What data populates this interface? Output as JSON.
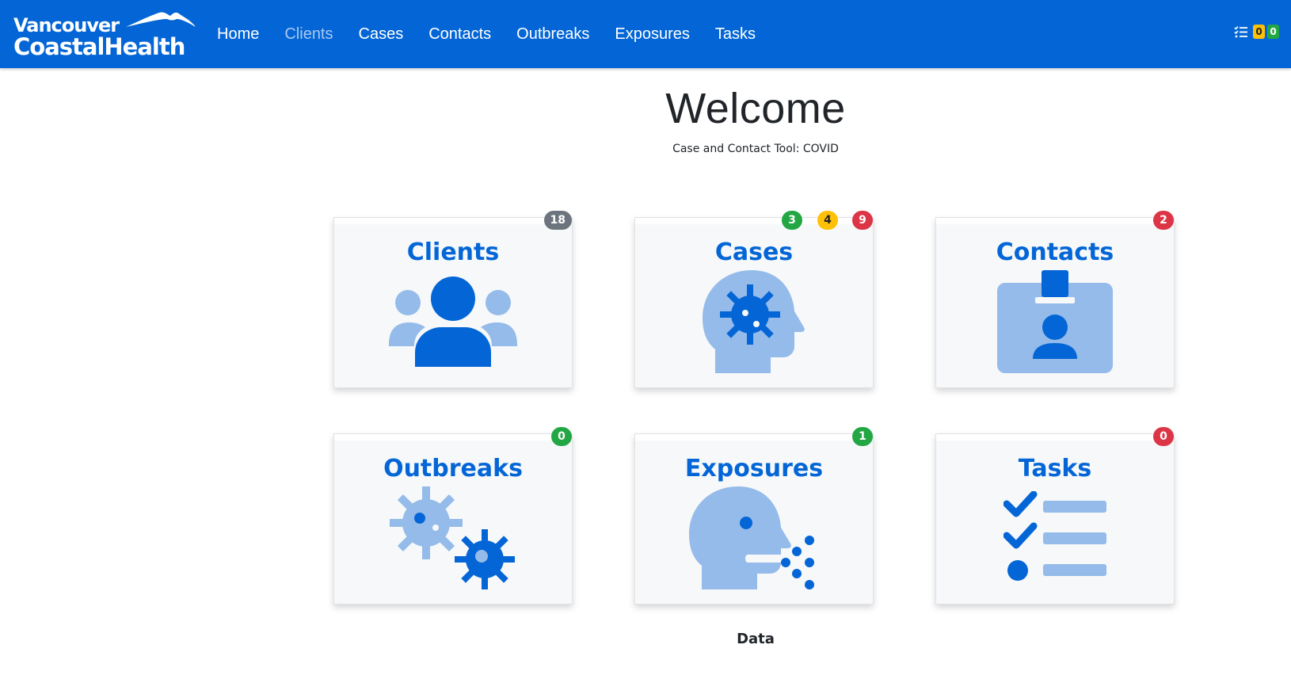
{
  "header": {
    "brand_line1": "Vancouver",
    "brand_line2": "CoastalHealth",
    "nav": [
      "Home",
      "Clients",
      "Cases",
      "Contacts",
      "Outbreaks",
      "Exposures",
      "Tasks"
    ],
    "active_nav": "Clients",
    "task_badges": {
      "pending": "0",
      "done": "0"
    }
  },
  "welcome": {
    "title": "Welcome",
    "subtitle": "Case and Contact Tool: COVID"
  },
  "cards": [
    {
      "label": "Clients",
      "icon": "clients-icon",
      "badges": [
        {
          "value": "18",
          "color": "gray"
        }
      ]
    },
    {
      "label": "Cases",
      "icon": "cases-icon",
      "badges": [
        {
          "value": "3",
          "color": "green"
        },
        {
          "value": "4",
          "color": "yellow"
        },
        {
          "value": "9",
          "color": "red"
        }
      ]
    },
    {
      "label": "Contacts",
      "icon": "contacts-icon",
      "badges": [
        {
          "value": "2",
          "color": "red"
        }
      ]
    },
    {
      "label": "Outbreaks",
      "icon": "outbreaks-icon",
      "badges": [
        {
          "value": "0",
          "color": "green"
        }
      ]
    },
    {
      "label": "Exposures",
      "icon": "exposures-icon",
      "badges": [
        {
          "value": "1",
          "color": "green"
        }
      ]
    },
    {
      "label": "Tasks",
      "icon": "tasks-icon",
      "badges": [
        {
          "value": "0",
          "color": "red"
        }
      ]
    }
  ],
  "footer": {
    "label": "Data"
  },
  "colors": {
    "primary": "#0466d6",
    "light_blue": "#94bbe9",
    "card_bg": "#f6f8fa",
    "badge_gray": "#6c757d",
    "badge_green": "#22a744",
    "badge_yellow": "#ffc107",
    "badge_red": "#dc3545"
  }
}
